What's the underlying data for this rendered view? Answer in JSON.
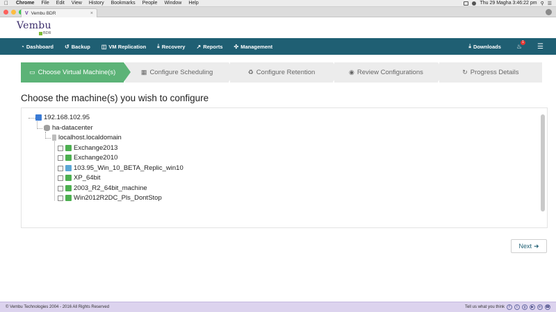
{
  "menubar": {
    "items": [
      "Chrome",
      "File",
      "Edit",
      "View",
      "History",
      "Bookmarks",
      "People",
      "Window",
      "Help"
    ],
    "datetime": "Thu 29 Magha  3:46:22 pm"
  },
  "browser": {
    "tab_title": "Vembu BDR"
  },
  "header": {
    "logo_text": "Vembu",
    "logo_sub": "BDR"
  },
  "nav": {
    "items": [
      {
        "label": "Dashboard",
        "icon": "dashboard-icon"
      },
      {
        "label": "Backup",
        "icon": "backup-icon"
      },
      {
        "label": "VM Replication",
        "icon": "vm-replication-icon"
      },
      {
        "label": "Recovery",
        "icon": "recovery-icon"
      },
      {
        "label": "Reports",
        "icon": "reports-icon"
      },
      {
        "label": "Management",
        "icon": "management-icon"
      }
    ],
    "downloads": "Downloads",
    "notification_count": "1"
  },
  "wizard": {
    "steps": [
      {
        "label": "Choose Virtual Machine(s)",
        "active": true
      },
      {
        "label": "Configure Scheduling",
        "active": false
      },
      {
        "label": "Configure Retention",
        "active": false
      },
      {
        "label": "Review Configurations",
        "active": false
      },
      {
        "label": "Progress Details",
        "active": false
      }
    ]
  },
  "main": {
    "title": "Choose the machine(s) you wish to configure",
    "tree": {
      "server": "192.168.102.95",
      "datacenter": "ha-datacenter",
      "host": "localhost.localdomain",
      "vms": [
        {
          "name": "Exchange2013",
          "state": "on"
        },
        {
          "name": "Exchange2010",
          "state": "on"
        },
        {
          "name": "103.95_Win_10_BETA_Replic_win10",
          "state": "off"
        },
        {
          "name": "XP_64bit",
          "state": "on"
        },
        {
          "name": "2003_R2_64bit_machine",
          "state": "on"
        },
        {
          "name": "Win2012R2DC_Pls_DontStop",
          "state": "on"
        }
      ]
    },
    "next_label": "Next"
  },
  "footer": {
    "copyright": "© Vembu Technologies   2004 - 2016   All Rights Reserved",
    "feedback": "Tell us what you think"
  },
  "colors": {
    "nav_bg": "#1f5f73",
    "active_step": "#5cb377",
    "footer_bg": "#dcd3ee"
  }
}
